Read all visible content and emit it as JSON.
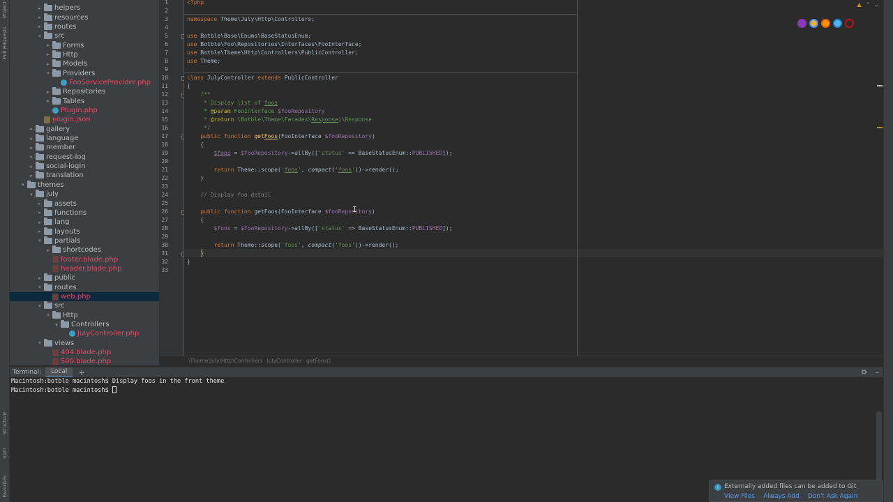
{
  "tool_strip": {
    "top_tabs": [
      "Project",
      "Pull Requests"
    ],
    "bottom_tabs": [
      "Structure",
      "npm",
      "Favorites"
    ]
  },
  "tree": {
    "items": [
      {
        "label": "helpers",
        "kind": "folder",
        "open": false,
        "level": 3
      },
      {
        "label": "resources",
        "kind": "folder",
        "open": false,
        "level": 3
      },
      {
        "label": "routes",
        "kind": "folder",
        "open": false,
        "level": 3
      },
      {
        "label": "src",
        "kind": "folder",
        "open": true,
        "level": 3
      },
      {
        "label": "Forms",
        "kind": "folder",
        "open": false,
        "level": 4
      },
      {
        "label": "Http",
        "kind": "folder",
        "open": false,
        "level": 4
      },
      {
        "label": "Models",
        "kind": "folder",
        "open": false,
        "level": 4
      },
      {
        "label": "Providers",
        "kind": "folder",
        "open": true,
        "level": 4
      },
      {
        "label": "FooServiceProvider.php",
        "kind": "cls",
        "level": 5,
        "color": "red"
      },
      {
        "label": "Repositories",
        "kind": "folder",
        "open": false,
        "level": 4
      },
      {
        "label": "Tables",
        "kind": "folder",
        "open": false,
        "level": 4
      },
      {
        "label": "Plugin.php",
        "kind": "cls",
        "level": 4,
        "color": "red"
      },
      {
        "label": "plugin.json",
        "kind": "json",
        "level": 3,
        "color": "red"
      },
      {
        "label": "gallery",
        "kind": "folder",
        "open": false,
        "level": 2
      },
      {
        "label": "language",
        "kind": "folder",
        "open": false,
        "level": 2
      },
      {
        "label": "member",
        "kind": "folder",
        "open": false,
        "level": 2
      },
      {
        "label": "request-log",
        "kind": "folder",
        "open": false,
        "level": 2
      },
      {
        "label": "social-login",
        "kind": "folder",
        "open": false,
        "level": 2
      },
      {
        "label": "translation",
        "kind": "folder",
        "open": false,
        "level": 2
      },
      {
        "label": "themes",
        "kind": "folder",
        "open": true,
        "level": 1
      },
      {
        "label": "july",
        "kind": "folder",
        "open": true,
        "level": 2
      },
      {
        "label": "assets",
        "kind": "folder",
        "open": false,
        "level": 3
      },
      {
        "label": "functions",
        "kind": "folder",
        "open": false,
        "level": 3
      },
      {
        "label": "lang",
        "kind": "folder",
        "open": false,
        "level": 3
      },
      {
        "label": "layouts",
        "kind": "folder",
        "open": false,
        "level": 3
      },
      {
        "label": "partials",
        "kind": "folder",
        "open": true,
        "level": 3
      },
      {
        "label": "shortcodes",
        "kind": "folder",
        "open": false,
        "level": 4
      },
      {
        "label": "footer.blade.php",
        "kind": "php",
        "level": 4,
        "color": "red"
      },
      {
        "label": "header.blade.php",
        "kind": "php",
        "level": 4,
        "color": "red"
      },
      {
        "label": "public",
        "kind": "folder",
        "open": false,
        "level": 3
      },
      {
        "label": "routes",
        "kind": "folder",
        "open": true,
        "level": 3
      },
      {
        "label": "web.php",
        "kind": "php",
        "level": 4,
        "color": "red",
        "selected": true
      },
      {
        "label": "src",
        "kind": "folder",
        "open": true,
        "level": 3
      },
      {
        "label": "Http",
        "kind": "folder",
        "open": true,
        "level": 4
      },
      {
        "label": "Controllers",
        "kind": "folder",
        "open": true,
        "level": 5
      },
      {
        "label": "JulyController.php",
        "kind": "cls",
        "level": 6,
        "color": "red"
      },
      {
        "label": "views",
        "kind": "folder",
        "open": true,
        "level": 3
      },
      {
        "label": "404.blade.php",
        "kind": "php",
        "level": 4,
        "color": "red"
      },
      {
        "label": "500.blade.php",
        "kind": "php",
        "level": 4,
        "color": "red"
      }
    ]
  },
  "editor": {
    "line_count": 33,
    "breadcrumb": [
      "\\Theme\\July\\Http\\Controllers",
      "JulyController",
      "getFoos()"
    ],
    "browser_icons": [
      "phpstorm-icon",
      "chrome-icon",
      "firefox-icon",
      "safari-icon",
      "opera-icon"
    ],
    "colors": {
      "keyword": "#cc7832",
      "variable": "#9876aa",
      "string": "#6a8759",
      "comment": "#808080",
      "function": "#ffc66d",
      "doc_tag": "#bbb529",
      "doc": "#629755"
    }
  },
  "terminal": {
    "title": "Terminal:",
    "tab": "Local",
    "add": "+",
    "lines": [
      "Macintosh:botble macintosh$ Display foos in the front theme",
      "Macintosh:botble macintosh$ "
    ]
  },
  "notification": {
    "text": "Externally added files can be added to Git",
    "actions": [
      "View Files",
      "Always Add",
      "Don't Ask Again"
    ]
  }
}
